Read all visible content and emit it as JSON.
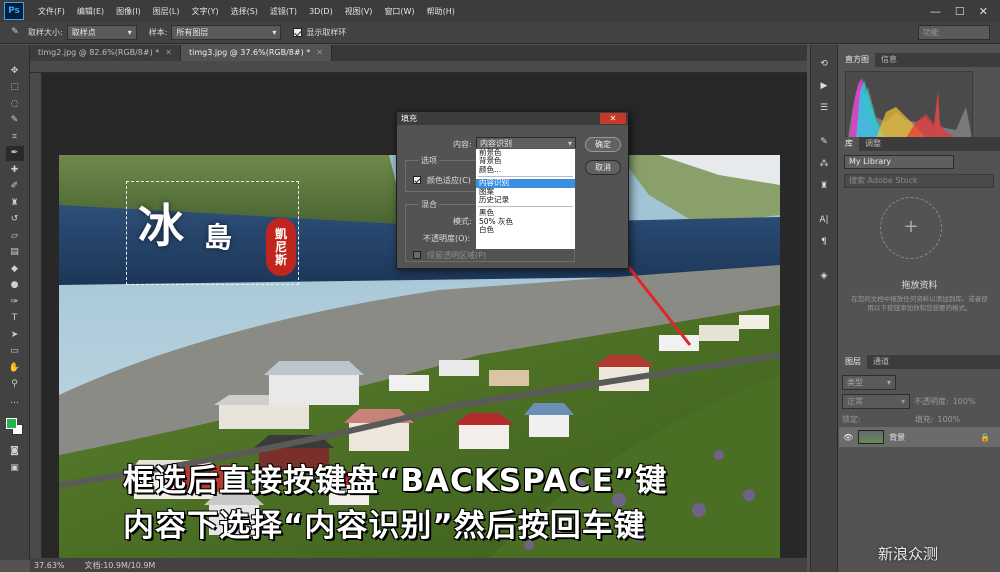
{
  "app": {
    "logo": "Ps"
  },
  "menu": [
    "文件(F)",
    "编辑(E)",
    "图像(I)",
    "图层(L)",
    "文字(Y)",
    "选择(S)",
    "滤镜(T)",
    "3D(D)",
    "视图(V)",
    "窗口(W)",
    "帮助(H)"
  ],
  "window_controls": [
    "—",
    "☐",
    "✕"
  ],
  "options": {
    "sample_size_label": "取样大小:",
    "sample_size_value": "取样点",
    "sample_label": "样本:",
    "sample_value": "所有图层",
    "show_ring_label": "显示取样环",
    "show_ring_checked": true,
    "workspace": "功能"
  },
  "tabs": [
    {
      "label": "timg2.jpg @ 82.6%(RGB/8#) *",
      "active": false
    },
    {
      "label": "timg3.jpg @ 37.6%(RGB/8#) *",
      "active": true
    }
  ],
  "canvas": {
    "title_big": "冰",
    "title_small": "島",
    "seal": [
      "凱",
      "尼",
      "斯"
    ],
    "overlay_line1": "框选后直接按键盘“BACKSPACE”键",
    "overlay_line2": "内容下选择“内容识别”然后按回车键"
  },
  "status": {
    "zoom": "37.63%",
    "doc": "文档:10.9M/10.9M"
  },
  "fill_dialog": {
    "title": "填充",
    "content_label": "内容:",
    "content_value": "内容识别",
    "ok": "确定",
    "cancel": "取消",
    "options_group": "选项",
    "color_adapt": "颜色适应(C)",
    "color_adapt_checked": true,
    "blend_group": "混合",
    "mode_label": "模式:",
    "opacity_label": "不透明度(O):",
    "preserve_label": "保留透明区域(P)",
    "dropdown": [
      "前景色",
      "背景色",
      "颜色...",
      "内容识别",
      "图案",
      "历史记录",
      "黑色",
      "50% 灰色",
      "白色"
    ],
    "dropdown_selected": "内容识别"
  },
  "histogram_panel": {
    "tabs": [
      "直方图",
      "信息"
    ]
  },
  "library_panel": {
    "tabs": [
      "库",
      "调整"
    ],
    "library_name": "My Library",
    "search_placeholder": "搜索 Adobe Stock",
    "drag_label": "拖放资料",
    "help_text": "在您的文档中拖放任何资料以添加到库。或者使用以下按钮添加你和您想要的格式。"
  },
  "layers_panel": {
    "tabs": [
      "图层",
      "通道"
    ],
    "kind_label": "类型",
    "blend_mode": "正常",
    "opacity_label": "不透明度:",
    "opacity_value": "100%",
    "lock_label": "锁定:",
    "fill_label": "填充:",
    "fill_value": "100%",
    "layer_name": "背景"
  },
  "watermark": "新浪众测",
  "colors": {
    "foreground": "#27b24a",
    "background": "#ffffff",
    "accent": "#31a8ff",
    "seal": "#c0261d",
    "highlight": "#3b8fe0"
  }
}
